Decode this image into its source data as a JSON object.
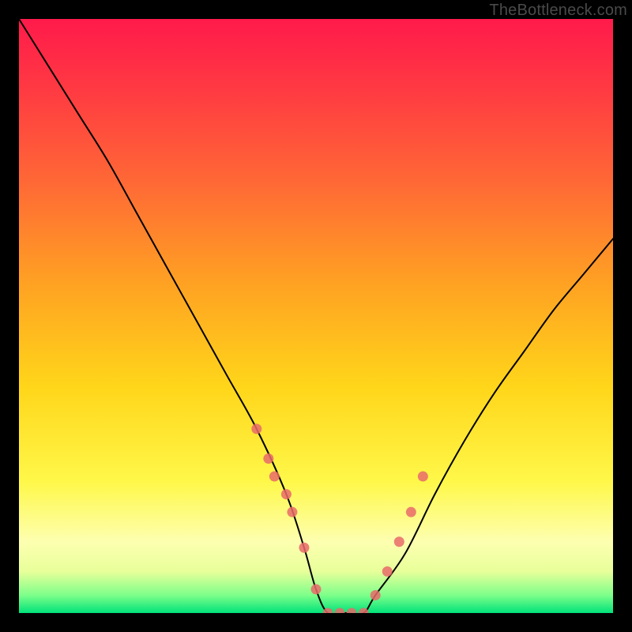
{
  "watermark": "TheBottleneck.com",
  "chart_data": {
    "type": "line",
    "title": "",
    "xlabel": "",
    "ylabel": "",
    "xlim": [
      0,
      100
    ],
    "ylim": [
      0,
      100
    ],
    "series": [
      {
        "name": "bottleneck-curve",
        "x": [
          0,
          5,
          10,
          15,
          20,
          25,
          30,
          35,
          40,
          45,
          48,
          50,
          52,
          55,
          58,
          60,
          65,
          70,
          75,
          80,
          85,
          90,
          95,
          100
        ],
        "y": [
          100,
          92,
          84,
          76,
          67,
          58,
          49,
          40,
          31,
          20,
          11,
          4,
          0,
          0,
          0,
          3,
          10,
          20,
          29,
          37,
          44,
          51,
          57,
          63
        ]
      }
    ],
    "markers": {
      "name": "highlight-points",
      "x": [
        40,
        42,
        43,
        45,
        46,
        48,
        50,
        52,
        54,
        56,
        58,
        60,
        62,
        64,
        66,
        68
      ],
      "y": [
        31,
        26,
        23,
        20,
        17,
        11,
        4,
        0,
        0,
        0,
        0,
        3,
        7,
        12,
        17,
        23
      ]
    },
    "background_gradient": {
      "top": "#ff1a4b",
      "mid": "#ffd61a",
      "bottom": "#00e27a"
    }
  }
}
